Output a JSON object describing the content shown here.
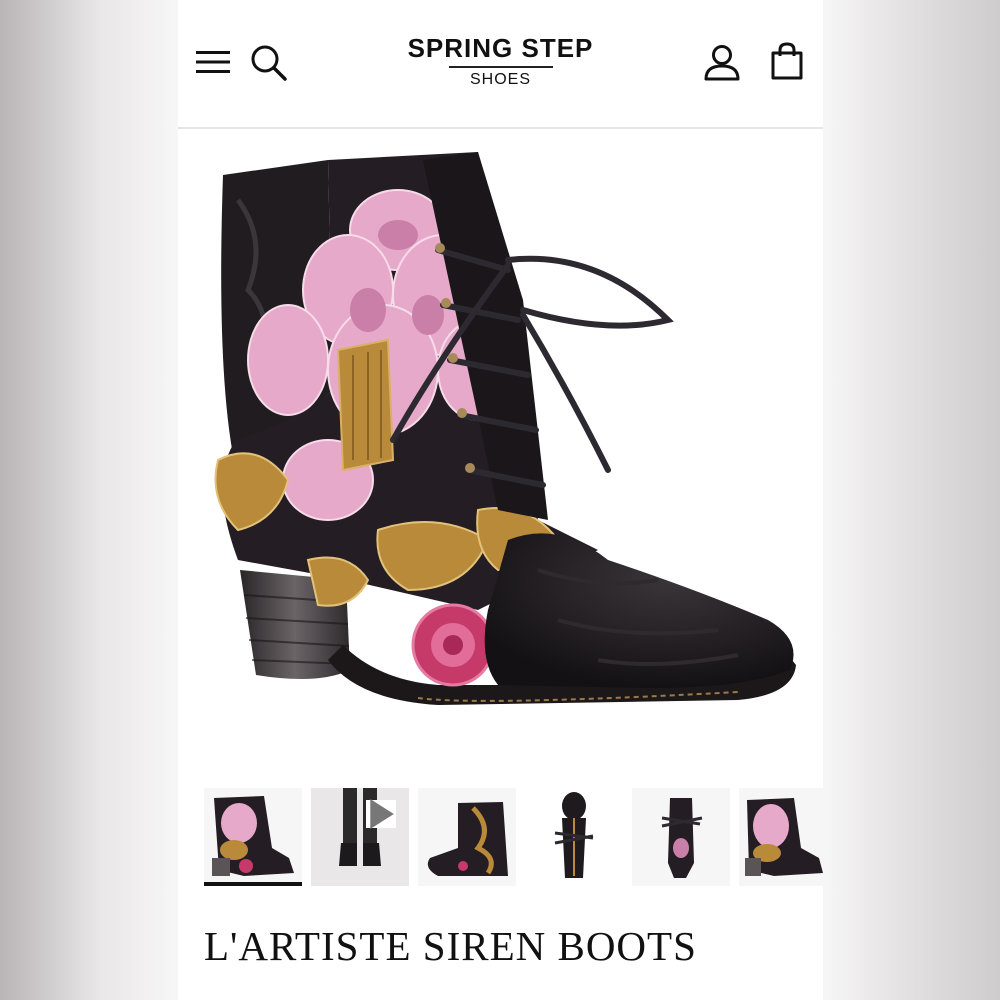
{
  "brand": {
    "name": "SPRING STEP",
    "sub": "SHOES"
  },
  "header_icons": [
    "menu-icon",
    "search-icon",
    "account-icon",
    "bag-icon"
  ],
  "product": {
    "title": "L'ARTISTE SIREN BOOTS"
  },
  "gallery": {
    "thumbnails": [
      {
        "label": "side view",
        "active": true
      },
      {
        "label": "video on model",
        "video": true
      },
      {
        "label": "outer side view"
      },
      {
        "label": "top-down view"
      },
      {
        "label": "back view"
      },
      {
        "label": "side view detail"
      }
    ]
  },
  "colors": {
    "ink": "#111111",
    "boot_black": "#1e1a1d",
    "floral_pink": "#e7a9c9",
    "floral_gold": "#b88a3a",
    "rose_red": "#c63a6a"
  }
}
